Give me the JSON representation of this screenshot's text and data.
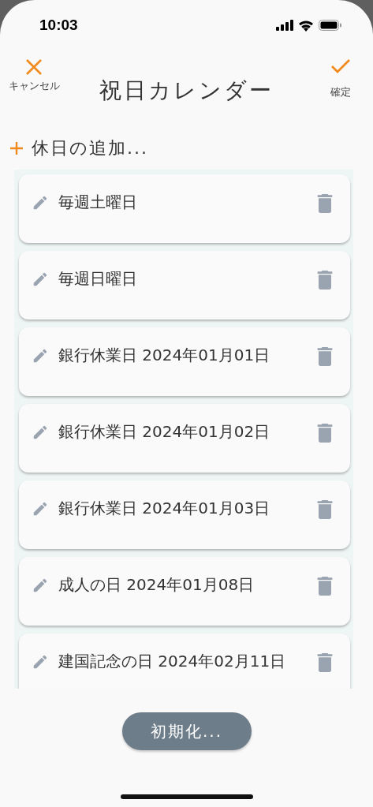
{
  "status_bar": {
    "time": "10:03"
  },
  "header": {
    "cancel_label": "キャンセル",
    "title": "祝日カレンダー",
    "confirm_label": "確定"
  },
  "add_holiday": {
    "label": "休日の追加..."
  },
  "holidays": [
    {
      "text": "毎週土曜日"
    },
    {
      "text": "毎週日曜日"
    },
    {
      "text": "銀行休業日 2024年01月01日"
    },
    {
      "text": "銀行休業日 2024年01月02日"
    },
    {
      "text": "銀行休業日 2024年01月03日"
    },
    {
      "text": "成人の日 2024年01月08日"
    },
    {
      "text": "建国記念の日 2024年02月11日"
    }
  ],
  "reset_button": {
    "label": "初期化..."
  }
}
